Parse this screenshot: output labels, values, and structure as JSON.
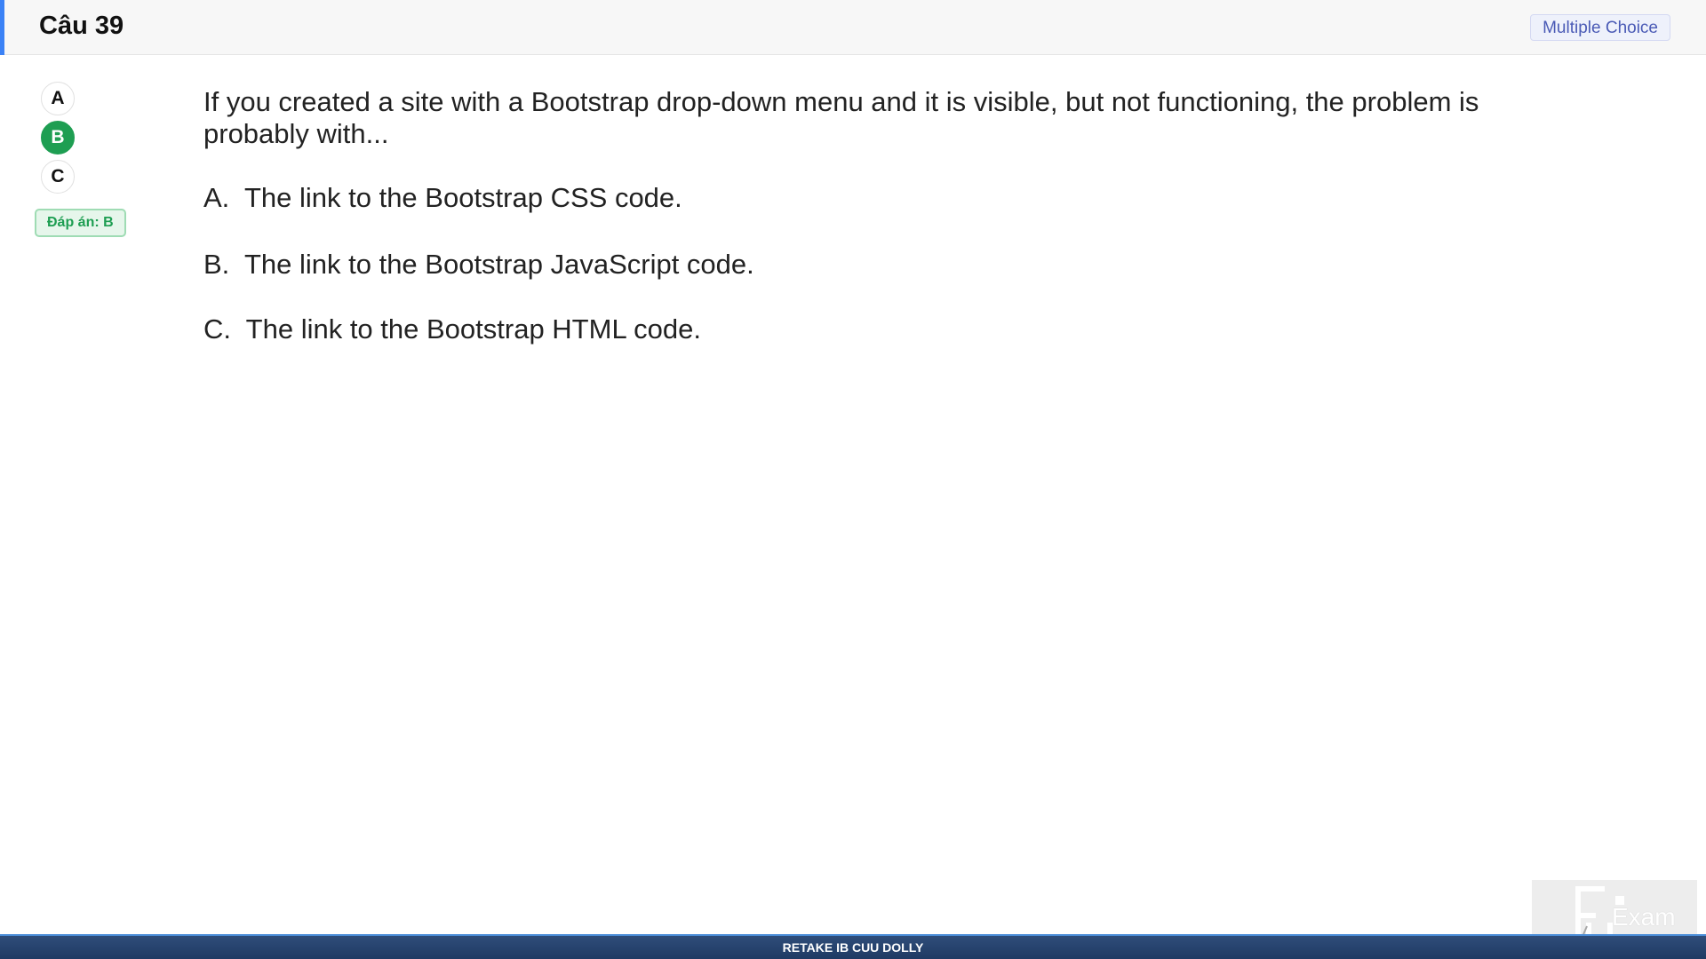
{
  "header": {
    "title": "Câu 39",
    "type_badge": "Multiple Choice",
    "accent_color": "#3b82f6"
  },
  "sidebar": {
    "options": [
      "A",
      "B",
      "C"
    ],
    "selected": "B",
    "answer_label": "Đáp án: B",
    "selected_color": "#1e9e52"
  },
  "question": {
    "text": "If you created a site with a Bootstrap drop-down menu and it is visible, but not functioning, the problem is probably with...",
    "choices": [
      "A.  The link to the Bootstrap CSS code.",
      "B.  The link to the Bootstrap JavaScript code.",
      "C.  The link to the Bootstrap HTML code."
    ]
  },
  "footer": {
    "text": "RETAKE IB CUU DOLLY"
  },
  "logo": {
    "text": "Exam",
    "icon": "fu-exam-logo-icon"
  }
}
